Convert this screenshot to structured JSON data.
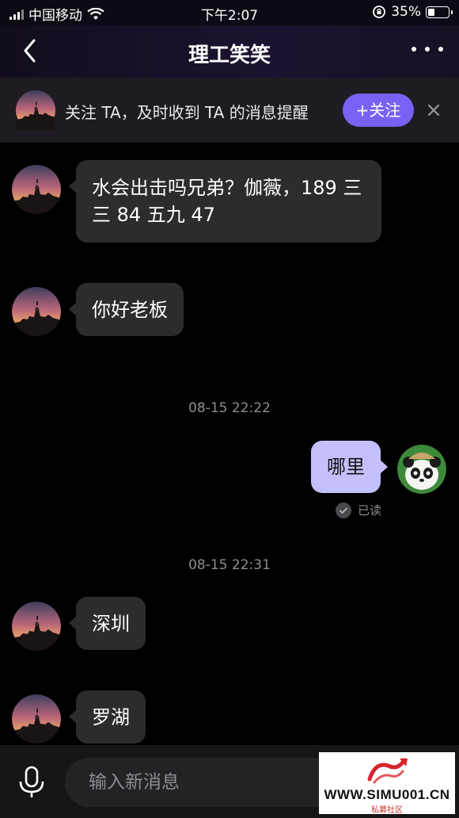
{
  "status_bar": {
    "carrier": "中国移动",
    "time": "下午2:07",
    "battery": "35%",
    "battery_level": 0.35
  },
  "nav": {
    "title": "理工笑笑"
  },
  "follow_banner": {
    "text": "关注 TA，及时收到 TA 的消息提醒",
    "follow_label": "+关注"
  },
  "messages": [
    {
      "text": "水会出击吗兄弟？伽薇，189 三三 84 五九 47"
    },
    {
      "text": "你好老板"
    },
    {
      "timestamp": "08-15  22:22"
    },
    {
      "text": "哪里",
      "status": "已读"
    },
    {
      "timestamp": "08-15  22:31"
    },
    {
      "text": "深圳"
    },
    {
      "text": "罗湖"
    }
  ],
  "composer": {
    "placeholder": "输入新消息"
  },
  "watermark": {
    "url": "WWW.SIMU001.CN",
    "subtitle": "私募社区"
  },
  "colors": {
    "accent": "#7b61f3",
    "outgoing_bubble": "#c3c0fb",
    "incoming_bubble": "#2c2c2e"
  }
}
